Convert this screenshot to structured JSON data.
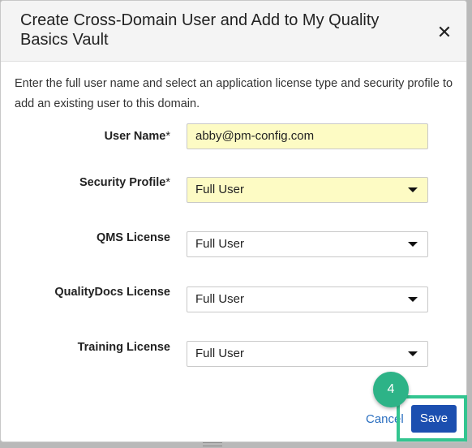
{
  "dialog": {
    "title": "Create Cross-Domain User and Add to My Quality Basics Vault",
    "close_icon": "close-icon",
    "intro": "Enter the full user name and select an application license type and security profile to add an existing user to this domain."
  },
  "form": {
    "user_name": {
      "label": "User Name",
      "required_mark": "*",
      "value": "abby@pm-config.com"
    },
    "security_profile": {
      "label": "Security Profile",
      "required_mark": "*",
      "value": "Full User"
    },
    "qms_license": {
      "label": "QMS License",
      "value": "Full User"
    },
    "qualitydocs_license": {
      "label": "QualityDocs License",
      "value": "Full User"
    },
    "training_license": {
      "label": "Training License",
      "value": "Full User"
    }
  },
  "footer": {
    "cancel_label": "Cancel",
    "save_label": "Save"
  },
  "overlay": {
    "step_number": "4",
    "highlight_color": "#33c590"
  },
  "colors": {
    "required_field_bg": "#fdfbc4",
    "save_button": "#1c4fb0",
    "link": "#2a6fc0"
  }
}
